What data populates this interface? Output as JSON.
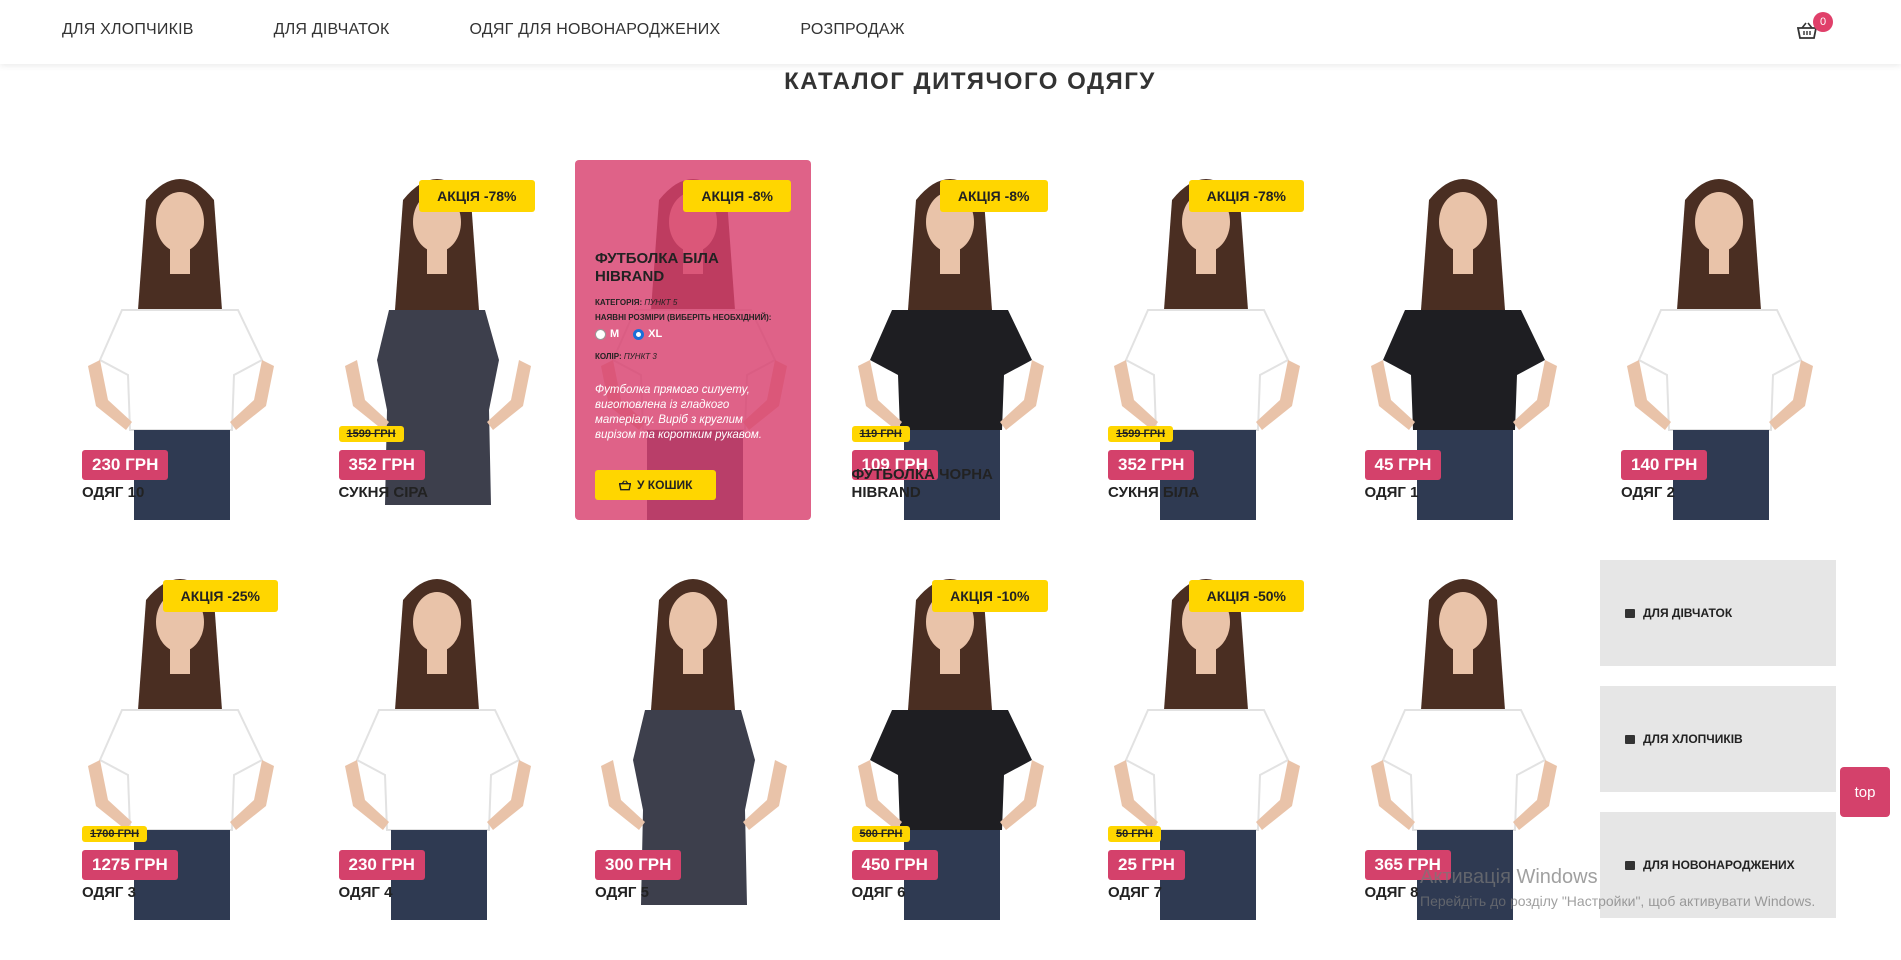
{
  "nav": {
    "items": [
      "Для хлопчиків",
      "Для дівчаток",
      "Одяг для новонароджених",
      "Розпродаж"
    ],
    "cart_count": "0"
  },
  "page_title": "Каталог дитячого одягу",
  "overlay": {
    "title": "Футболка біла Hibrand",
    "category_label": "Категорія:",
    "category_value": "Пункт 5",
    "sizes_label": "Наявні розміри (виберіть необхідний):",
    "sizes": [
      "M",
      "XL"
    ],
    "selected_size": "XL",
    "color_label": "Колір:",
    "color_value": "Пункт 3",
    "description": "Футболка прямого силуету, виготовлена із гладкого матеріалу. Виріб з круглим вирізом та коротким рукавом.",
    "button": "У кошик"
  },
  "products": [
    {
      "name": "Одяг 10",
      "price": "230 ГРН",
      "old_price": "",
      "promo": "",
      "garment": "white"
    },
    {
      "name": "Сукня сіра",
      "price": "352 ГРН",
      "old_price": "1599 ГРН",
      "promo": "АКЦІЯ -78%",
      "garment": "dress"
    },
    {
      "name": "",
      "price": "",
      "old_price": "",
      "promo": "АКЦІЯ -8%",
      "garment": "overlay"
    },
    {
      "name": "Футболка чорна Hibrand",
      "price": "109 ГРН",
      "old_price": "119 ГРН",
      "promo": "АКЦІЯ -8%",
      "garment": "black"
    },
    {
      "name": "Сукня біла",
      "price": "352 ГРН",
      "old_price": "1599 ГРН",
      "promo": "АКЦІЯ -78%",
      "garment": "white"
    },
    {
      "name": "Одяг 1",
      "price": "45 ГРН",
      "old_price": "",
      "promo": "",
      "garment": "black"
    },
    {
      "name": "Одяг 2",
      "price": "140 ГРН",
      "old_price": "",
      "promo": "",
      "garment": "white"
    },
    {
      "name": "Одяг 3",
      "price": "1275 ГРН",
      "old_price": "1700 ГРН",
      "promo": "АКЦІЯ -25%",
      "garment": "white"
    },
    {
      "name": "Одяг 4",
      "price": "230 ГРН",
      "old_price": "",
      "promo": "",
      "garment": "white"
    },
    {
      "name": "Одяг 5",
      "price": "300 ГРН",
      "old_price": "",
      "promo": "",
      "garment": "dress"
    },
    {
      "name": "Одяг 6",
      "price": "450 ГРН",
      "old_price": "500 ГРН",
      "promo": "АКЦІЯ -10%",
      "garment": "black"
    },
    {
      "name": "Одяг 7",
      "price": "25 ГРН",
      "old_price": "50 ГРН",
      "promo": "АКЦІЯ -50%",
      "garment": "white"
    },
    {
      "name": "Одяг 8",
      "price": "365 ГРН",
      "old_price": "",
      "promo": "",
      "garment": "white"
    }
  ],
  "categories": [
    "Для дівчаток",
    "Для хлопчиків",
    "Для новонароджених"
  ],
  "top_button": "top",
  "windows_watermark": {
    "line1": "Активація Windows",
    "line2": "Перейдіть до розділу \"Настройки\", щоб активувати Windows."
  },
  "colors": {
    "accent": "#d4416b",
    "promo": "#ffd600",
    "tile": "#e6e6e6"
  }
}
